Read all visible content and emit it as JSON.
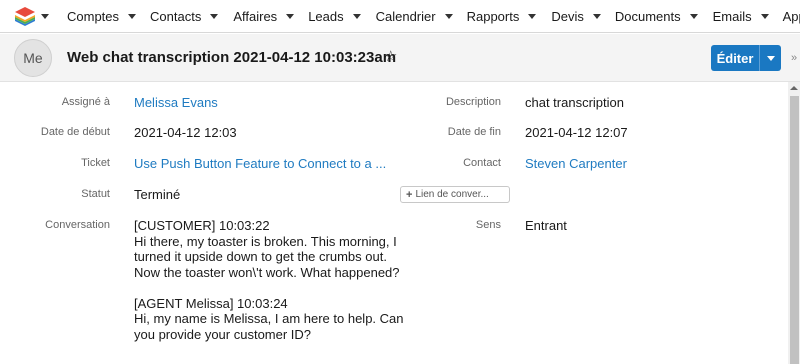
{
  "nav": {
    "items": [
      "Comptes",
      "Contacts",
      "Affaires",
      "Leads",
      "Calendrier",
      "Rapports",
      "Devis",
      "Documents",
      "Emails",
      "Appels"
    ]
  },
  "header": {
    "avatar_initials": "Me",
    "title": "Web chat transcription 2021-04-12 10:03:23am",
    "star_icon": "☆",
    "edit_label": "Éditer"
  },
  "fields": {
    "assigne_label": "Assigné à",
    "assigne_value": "Melissa Evans",
    "description_label": "Description",
    "description_value": "chat transcription",
    "debut_label": "Date de début",
    "debut_value": "2021-04-12 12:03",
    "fin_label": "Date de fin",
    "fin_value": "2021-04-12 12:07",
    "ticket_label": "Ticket",
    "ticket_value": "Use Push Button Feature to Connect to a ...",
    "contact_label": "Contact",
    "contact_value": "Steven Carpenter",
    "statut_label": "Statut",
    "statut_value": "Terminé",
    "conv_link_label": "Lien de conver...",
    "conversation_label": "Conversation",
    "sens_label": "Sens",
    "sens_value": "Entrant"
  },
  "conversation": {
    "customer_header": "[CUSTOMER] 10:03:22",
    "customer_text": "Hi there, my toaster is broken. This morning, I turned it upside down to get the crumbs out. Now the toaster won\\'t work. What happened?",
    "agent_header": "[AGENT Melissa] 10:03:24",
    "agent_text": "Hi, my name is Melissa, I am here to help. Can you provide your customer ID?"
  },
  "colors": {
    "accent": "#1a78c2",
    "link": "#1f7bc1"
  },
  "icons": {
    "logo": "layers-logo-icon",
    "star": "star-icon",
    "chevron": "double-chevron-right-icon"
  }
}
